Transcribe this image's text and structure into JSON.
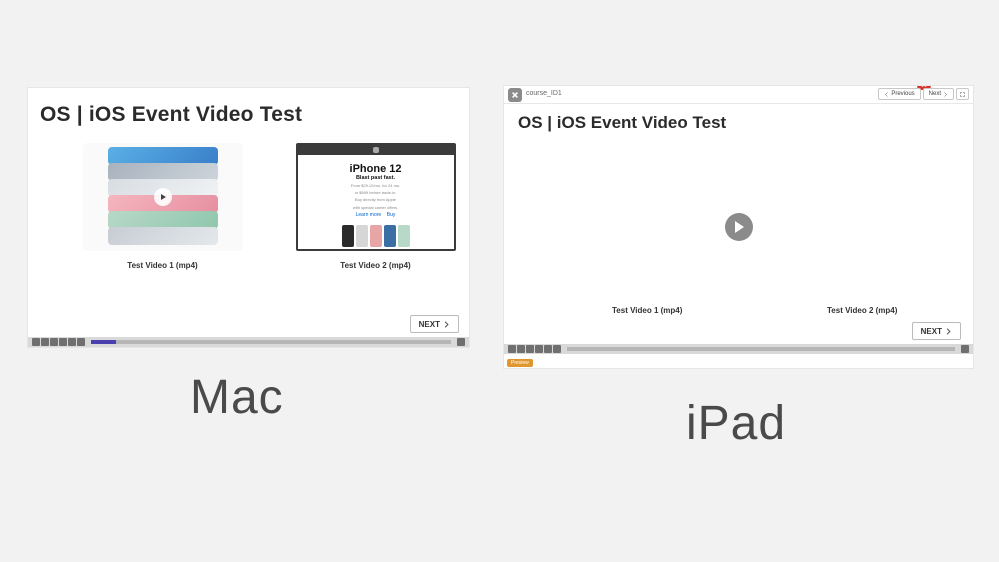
{
  "labels": {
    "mac": "Mac",
    "ipad": "iPad"
  },
  "mac": {
    "title": "OS | iOS Event Video Test",
    "video1_caption": "Test Video 1 (mp4)",
    "video2_caption": "Test Video 2 (mp4)",
    "next_label": "NEXT",
    "seek_progress_pct": 7,
    "iphone_card": {
      "headline": "iPhone 12",
      "sub": "Blast past fast.",
      "fine1": "From $29.12/mo. for 24 mo.",
      "fine2": "or $699 before trade-in.",
      "fine3": "Buy directly from Apple",
      "fine4": "with special carrier offers.",
      "link1": "Learn more",
      "link2": "Buy"
    }
  },
  "ipad": {
    "course_label": "course_ID1",
    "title": "OS | iOS Event Video Test",
    "video1_caption": "Test Video 1 (mp4)",
    "video2_caption": "Test Video 2 (mp4)",
    "next_label": "NEXT",
    "prev_label": "Previous",
    "toolbar_next_label": "Next",
    "preview_badge": "Preview",
    "seek_progress_pct": 0
  }
}
